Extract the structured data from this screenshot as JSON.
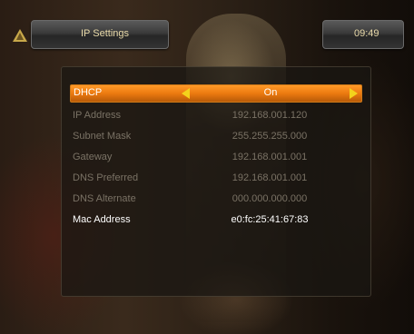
{
  "header": {
    "title": "IP Settings",
    "clock": "09:49"
  },
  "settings": [
    {
      "label": "DHCP",
      "value": "On"
    },
    {
      "label": "IP Address",
      "value": "192.168.001.120"
    },
    {
      "label": "Subnet Mask",
      "value": "255.255.255.000"
    },
    {
      "label": "Gateway",
      "value": "192.168.001.001"
    },
    {
      "label": "DNS Preferred",
      "value": "192.168.001.001"
    },
    {
      "label": "DNS Alternate",
      "value": "000.000.000.000"
    },
    {
      "label": "Mac Address",
      "value": "e0:fc:25:41:67:83"
    }
  ],
  "colors": {
    "accent": "#ec7a10",
    "arrow": "#f3d21c",
    "header_text": "#e8d9a8"
  },
  "icons": {
    "logo": "brand-logo-icon",
    "prev": "arrow-left-icon",
    "next": "arrow-right-icon"
  }
}
